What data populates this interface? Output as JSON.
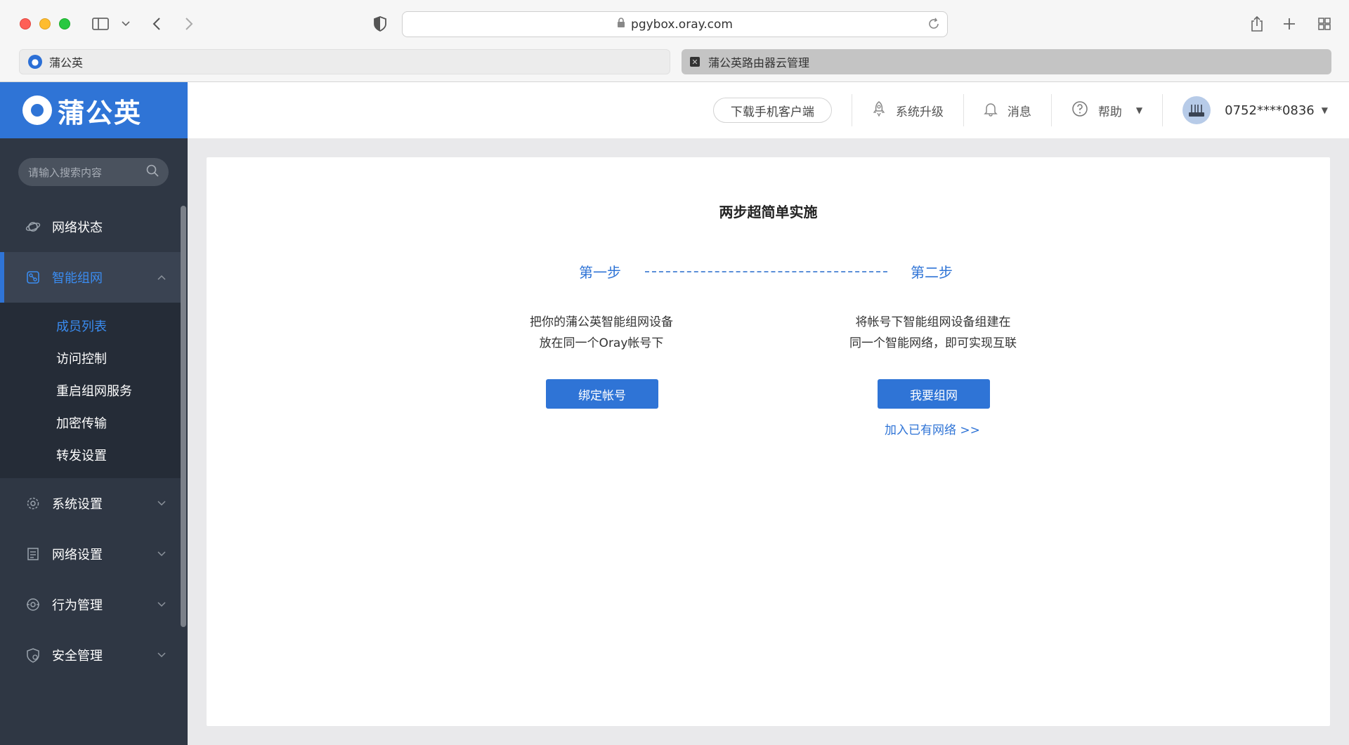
{
  "browser": {
    "url": "pgybox.oray.com",
    "tabs": [
      {
        "label": "蒲公英",
        "active": true
      },
      {
        "label": "蒲公英路由器云管理",
        "active": false
      }
    ]
  },
  "sidebar": {
    "brand": "蒲公英",
    "search_placeholder": "请输入搜索内容",
    "items": [
      {
        "label": "网络状态",
        "icon": "network-status-icon"
      },
      {
        "label": "智能组网",
        "icon": "smart-network-icon",
        "open": true,
        "children": [
          "成员列表",
          "访问控制",
          "重启组网服务",
          "加密传输",
          "转发设置"
        ]
      },
      {
        "label": "系统设置",
        "icon": "gear-icon"
      },
      {
        "label": "网络设置",
        "icon": "network-settings-icon"
      },
      {
        "label": "行为管理",
        "icon": "behavior-icon"
      },
      {
        "label": "安全管理",
        "icon": "shield-icon"
      }
    ]
  },
  "header": {
    "download_label": "下载手机客户端",
    "upgrade_label": "系统升级",
    "message_label": "消息",
    "help_label": "帮助",
    "user": "0752****0836"
  },
  "main": {
    "title": "两步超简单实施",
    "step1": {
      "label": "第一步",
      "line1": "把你的蒲公英智能组网设备",
      "line2": "放在同一个Oray帐号下",
      "button": "绑定帐号"
    },
    "step2": {
      "label": "第二步",
      "line1": "将帐号下智能组网设备组建在",
      "line2": "同一个智能网络，即可实现互联",
      "button": "我要组网",
      "link": "加入已有网络 >>"
    }
  },
  "colors": {
    "accent": "#2f74d6",
    "sidebar_bg": "#2f3744"
  }
}
